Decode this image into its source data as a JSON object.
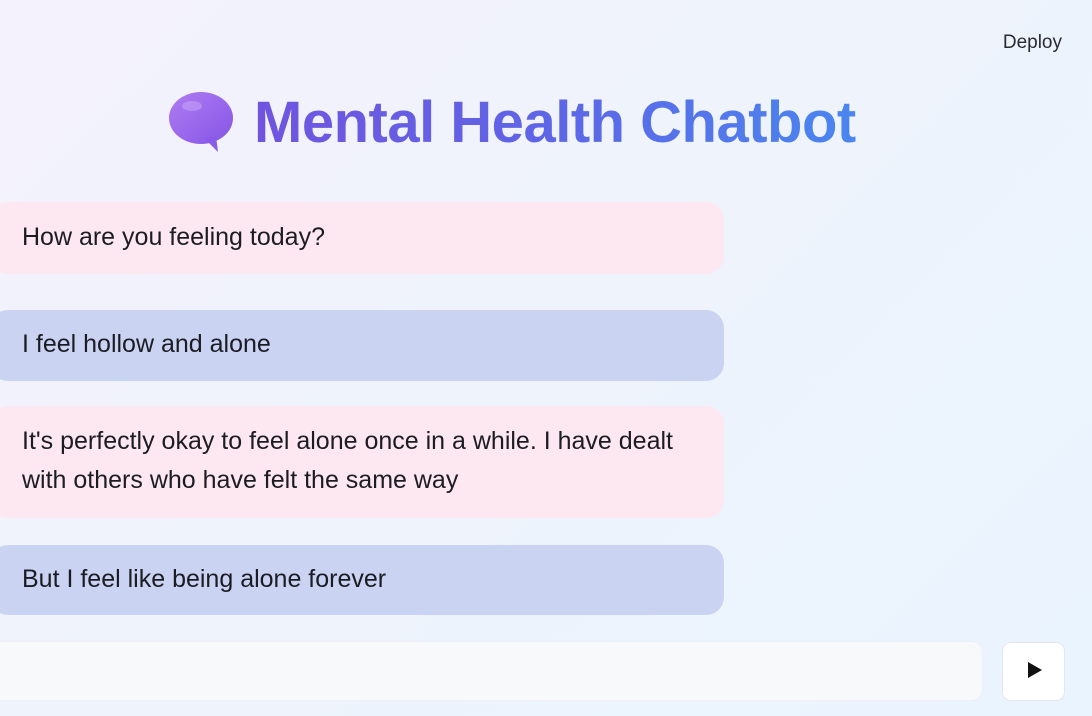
{
  "header": {
    "deploy_label": "Deploy"
  },
  "title": {
    "icon": "speech-bubble-icon",
    "text": "Mental Health Chatbot"
  },
  "messages": [
    {
      "role": "bot",
      "text": "How are you feeling today?"
    },
    {
      "role": "user",
      "text": "I feel hollow and alone"
    },
    {
      "role": "bot",
      "text": "It's perfectly okay to feel alone once in a while. I have dealt with others who have felt the same way"
    },
    {
      "role": "user",
      "text": "But I feel like being alone forever"
    }
  ],
  "input": {
    "value": "",
    "placeholder": ""
  },
  "send": {
    "icon": "play-icon"
  },
  "colors": {
    "bot_bubble": "#fde8f1",
    "user_bubble": "#cbd3f3",
    "title_gradient_start": "#7154e0",
    "title_gradient_end": "#4a86ef",
    "icon_purple": "#9b6cf0"
  }
}
